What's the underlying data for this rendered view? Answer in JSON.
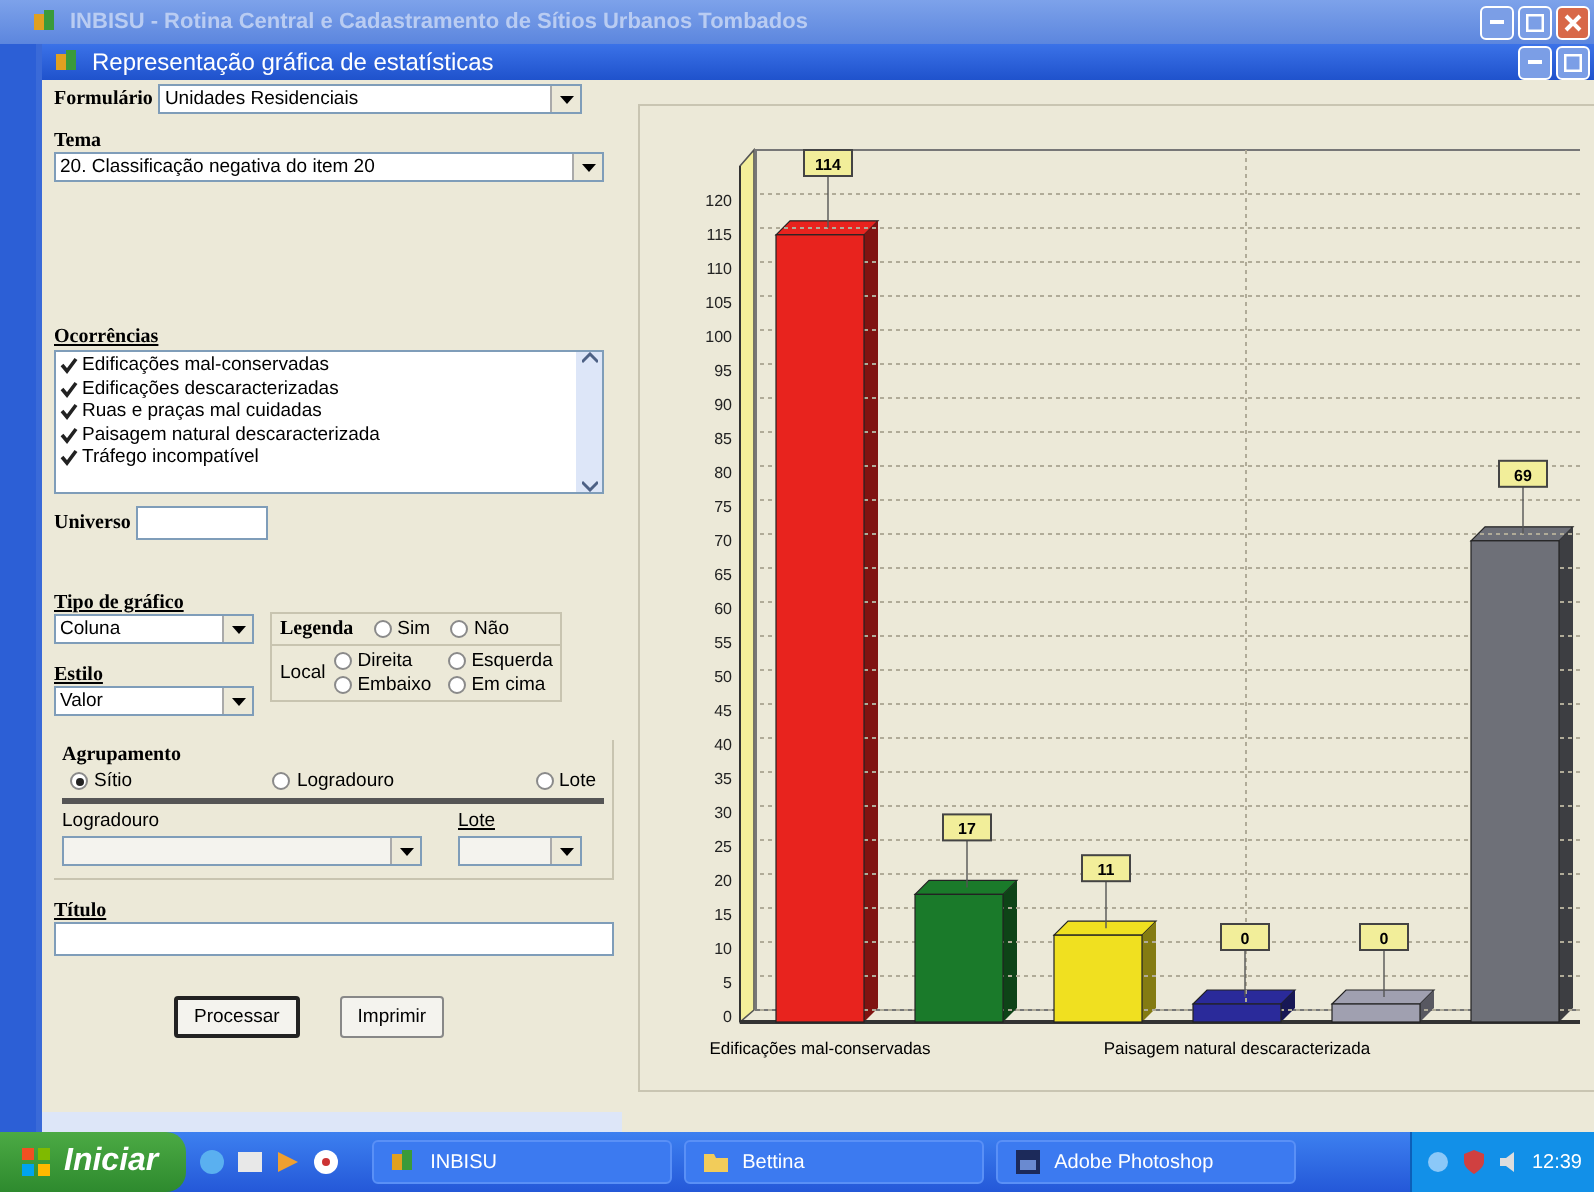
{
  "window": {
    "title": "INBISU - Rotina Central e Cadastramento de Sítios Urbanos Tombados"
  },
  "child_window": {
    "title": "Representação gráfica de estatísticas"
  },
  "form": {
    "formulario": {
      "label": "Formulário",
      "value": "Unidades Residenciais"
    },
    "tema": {
      "label": "Tema",
      "value": "20. Classificação negativa do item 20"
    },
    "ocorrencias": {
      "label": "Ocorrências",
      "items": [
        {
          "label": "Edificações mal-conservadas",
          "checked": true
        },
        {
          "label": "Edificações descaracterizadas",
          "checked": true
        },
        {
          "label": "Ruas e praças mal cuidadas",
          "checked": true
        },
        {
          "label": "Paisagem natural descaracterizada",
          "checked": true
        },
        {
          "label": "Tráfego incompatível",
          "checked": true
        }
      ]
    },
    "universo": {
      "label": "Universo"
    },
    "tipo_grafico": {
      "label": "Tipo de gráfico",
      "value": "Coluna"
    },
    "estilo": {
      "label": "Estilo",
      "value": "Valor"
    },
    "legenda": {
      "label": "Legenda",
      "options": [
        {
          "label": "Sim",
          "selected": false
        },
        {
          "label": "Não",
          "selected": false
        }
      ],
      "local_label": "Local",
      "local_options": [
        {
          "label": "Direita",
          "selected": false
        },
        {
          "label": "Esquerda",
          "selected": false
        },
        {
          "label": "Embaixo",
          "selected": false
        },
        {
          "label": "Em cima",
          "selected": false
        }
      ]
    },
    "agrupamento": {
      "label": "Agrupamento",
      "options": [
        {
          "label": "Sítio",
          "selected": true
        },
        {
          "label": "Logradouro",
          "selected": false
        },
        {
          "label": "Lote",
          "selected": false
        }
      ],
      "logradouro_label": "Logradouro",
      "lote_label": "Lote"
    },
    "titulo": {
      "label": "Título"
    },
    "buttons": [
      {
        "label": "Processar",
        "focused": true
      },
      {
        "label": "Imprimir",
        "focused": false
      }
    ]
  },
  "chart": {
    "chart_data": {
      "type": "bar",
      "categories": [
        "Edificações mal-conservadas",
        null,
        null,
        "Paisagem natural descaracterizada",
        null,
        null
      ],
      "series": [
        {
          "color": "#e8231e",
          "values": [
            114,
            null,
            null,
            null,
            null,
            null
          ],
          "value_labels": [
            "114",
            null,
            null,
            null,
            null,
            null
          ]
        },
        {
          "color": "#1a7a2a",
          "values": [
            null,
            17,
            null,
            null,
            null,
            null
          ],
          "value_labels": [
            null,
            "17",
            null,
            null,
            null,
            null
          ]
        },
        {
          "color": "#f0e020",
          "values": [
            null,
            null,
            11,
            null,
            null,
            null
          ],
          "value_labels": [
            null,
            null,
            "11",
            null,
            null,
            null
          ]
        },
        {
          "color": "#2a2a9a",
          "values": [
            null,
            null,
            null,
            0,
            null,
            null
          ],
          "value_labels": [
            null,
            null,
            null,
            "0",
            null,
            null
          ]
        },
        {
          "color": "#a0a0b0",
          "values": [
            null,
            null,
            null,
            null,
            0,
            null
          ],
          "value_labels": [
            null,
            null,
            null,
            null,
            "0",
            null
          ]
        },
        {
          "color": "#6e7078",
          "values": [
            null,
            null,
            null,
            null,
            null,
            69
          ],
          "value_labels": [
            null,
            null,
            null,
            null,
            null,
            "69"
          ]
        }
      ],
      "stacked": true,
      "grid": true,
      "ylim": [
        0,
        120
      ],
      "yticks": [
        0,
        5,
        10,
        15,
        20,
        25,
        30,
        35,
        40,
        45,
        50,
        55,
        60,
        65,
        70,
        75,
        80,
        85,
        90,
        95,
        100,
        105,
        110,
        115,
        120
      ]
    }
  },
  "taskbar": {
    "start": "Iniciar",
    "tasks": [
      {
        "label": "INBISU",
        "kind": "app"
      },
      {
        "label": "Bettina",
        "kind": "folder"
      },
      {
        "label": "Adobe Photoshop",
        "kind": "photoshop"
      }
    ],
    "clock": "12:39"
  }
}
